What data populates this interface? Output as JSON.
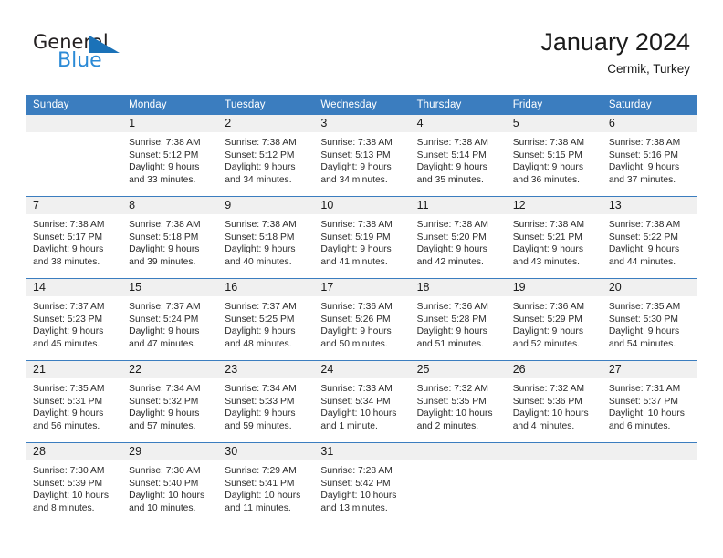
{
  "brand": {
    "name_top": "General",
    "name_bottom": "Blue",
    "triangle_color": "#1b72b8",
    "blue_color": "#2b8ad6"
  },
  "header": {
    "title": "January 2024",
    "subtitle": "Cermik, Turkey"
  },
  "theme": {
    "header_blue": "#3b7dbf",
    "daynum_band": "#f0f0f0",
    "text": "#222222"
  },
  "weekday_headers": [
    "Sunday",
    "Monday",
    "Tuesday",
    "Wednesday",
    "Thursday",
    "Friday",
    "Saturday"
  ],
  "weeks": [
    [
      {
        "day": "",
        "sunrise": "",
        "sunset": "",
        "daylight": ""
      },
      {
        "day": "1",
        "sunrise": "Sunrise: 7:38 AM",
        "sunset": "Sunset: 5:12 PM",
        "daylight": "Daylight: 9 hours and 33 minutes."
      },
      {
        "day": "2",
        "sunrise": "Sunrise: 7:38 AM",
        "sunset": "Sunset: 5:12 PM",
        "daylight": "Daylight: 9 hours and 34 minutes."
      },
      {
        "day": "3",
        "sunrise": "Sunrise: 7:38 AM",
        "sunset": "Sunset: 5:13 PM",
        "daylight": "Daylight: 9 hours and 34 minutes."
      },
      {
        "day": "4",
        "sunrise": "Sunrise: 7:38 AM",
        "sunset": "Sunset: 5:14 PM",
        "daylight": "Daylight: 9 hours and 35 minutes."
      },
      {
        "day": "5",
        "sunrise": "Sunrise: 7:38 AM",
        "sunset": "Sunset: 5:15 PM",
        "daylight": "Daylight: 9 hours and 36 minutes."
      },
      {
        "day": "6",
        "sunrise": "Sunrise: 7:38 AM",
        "sunset": "Sunset: 5:16 PM",
        "daylight": "Daylight: 9 hours and 37 minutes."
      }
    ],
    [
      {
        "day": "7",
        "sunrise": "Sunrise: 7:38 AM",
        "sunset": "Sunset: 5:17 PM",
        "daylight": "Daylight: 9 hours and 38 minutes."
      },
      {
        "day": "8",
        "sunrise": "Sunrise: 7:38 AM",
        "sunset": "Sunset: 5:18 PM",
        "daylight": "Daylight: 9 hours and 39 minutes."
      },
      {
        "day": "9",
        "sunrise": "Sunrise: 7:38 AM",
        "sunset": "Sunset: 5:18 PM",
        "daylight": "Daylight: 9 hours and 40 minutes."
      },
      {
        "day": "10",
        "sunrise": "Sunrise: 7:38 AM",
        "sunset": "Sunset: 5:19 PM",
        "daylight": "Daylight: 9 hours and 41 minutes."
      },
      {
        "day": "11",
        "sunrise": "Sunrise: 7:38 AM",
        "sunset": "Sunset: 5:20 PM",
        "daylight": "Daylight: 9 hours and 42 minutes."
      },
      {
        "day": "12",
        "sunrise": "Sunrise: 7:38 AM",
        "sunset": "Sunset: 5:21 PM",
        "daylight": "Daylight: 9 hours and 43 minutes."
      },
      {
        "day": "13",
        "sunrise": "Sunrise: 7:38 AM",
        "sunset": "Sunset: 5:22 PM",
        "daylight": "Daylight: 9 hours and 44 minutes."
      }
    ],
    [
      {
        "day": "14",
        "sunrise": "Sunrise: 7:37 AM",
        "sunset": "Sunset: 5:23 PM",
        "daylight": "Daylight: 9 hours and 45 minutes."
      },
      {
        "day": "15",
        "sunrise": "Sunrise: 7:37 AM",
        "sunset": "Sunset: 5:24 PM",
        "daylight": "Daylight: 9 hours and 47 minutes."
      },
      {
        "day": "16",
        "sunrise": "Sunrise: 7:37 AM",
        "sunset": "Sunset: 5:25 PM",
        "daylight": "Daylight: 9 hours and 48 minutes."
      },
      {
        "day": "17",
        "sunrise": "Sunrise: 7:36 AM",
        "sunset": "Sunset: 5:26 PM",
        "daylight": "Daylight: 9 hours and 50 minutes."
      },
      {
        "day": "18",
        "sunrise": "Sunrise: 7:36 AM",
        "sunset": "Sunset: 5:28 PM",
        "daylight": "Daylight: 9 hours and 51 minutes."
      },
      {
        "day": "19",
        "sunrise": "Sunrise: 7:36 AM",
        "sunset": "Sunset: 5:29 PM",
        "daylight": "Daylight: 9 hours and 52 minutes."
      },
      {
        "day": "20",
        "sunrise": "Sunrise: 7:35 AM",
        "sunset": "Sunset: 5:30 PM",
        "daylight": "Daylight: 9 hours and 54 minutes."
      }
    ],
    [
      {
        "day": "21",
        "sunrise": "Sunrise: 7:35 AM",
        "sunset": "Sunset: 5:31 PM",
        "daylight": "Daylight: 9 hours and 56 minutes."
      },
      {
        "day": "22",
        "sunrise": "Sunrise: 7:34 AM",
        "sunset": "Sunset: 5:32 PM",
        "daylight": "Daylight: 9 hours and 57 minutes."
      },
      {
        "day": "23",
        "sunrise": "Sunrise: 7:34 AM",
        "sunset": "Sunset: 5:33 PM",
        "daylight": "Daylight: 9 hours and 59 minutes."
      },
      {
        "day": "24",
        "sunrise": "Sunrise: 7:33 AM",
        "sunset": "Sunset: 5:34 PM",
        "daylight": "Daylight: 10 hours and 1 minute."
      },
      {
        "day": "25",
        "sunrise": "Sunrise: 7:32 AM",
        "sunset": "Sunset: 5:35 PM",
        "daylight": "Daylight: 10 hours and 2 minutes."
      },
      {
        "day": "26",
        "sunrise": "Sunrise: 7:32 AM",
        "sunset": "Sunset: 5:36 PM",
        "daylight": "Daylight: 10 hours and 4 minutes."
      },
      {
        "day": "27",
        "sunrise": "Sunrise: 7:31 AM",
        "sunset": "Sunset: 5:37 PM",
        "daylight": "Daylight: 10 hours and 6 minutes."
      }
    ],
    [
      {
        "day": "28",
        "sunrise": "Sunrise: 7:30 AM",
        "sunset": "Sunset: 5:39 PM",
        "daylight": "Daylight: 10 hours and 8 minutes."
      },
      {
        "day": "29",
        "sunrise": "Sunrise: 7:30 AM",
        "sunset": "Sunset: 5:40 PM",
        "daylight": "Daylight: 10 hours and 10 minutes."
      },
      {
        "day": "30",
        "sunrise": "Sunrise: 7:29 AM",
        "sunset": "Sunset: 5:41 PM",
        "daylight": "Daylight: 10 hours and 11 minutes."
      },
      {
        "day": "31",
        "sunrise": "Sunrise: 7:28 AM",
        "sunset": "Sunset: 5:42 PM",
        "daylight": "Daylight: 10 hours and 13 minutes."
      },
      {
        "day": "",
        "sunrise": "",
        "sunset": "",
        "daylight": ""
      },
      {
        "day": "",
        "sunrise": "",
        "sunset": "",
        "daylight": ""
      },
      {
        "day": "",
        "sunrise": "",
        "sunset": "",
        "daylight": ""
      }
    ]
  ]
}
